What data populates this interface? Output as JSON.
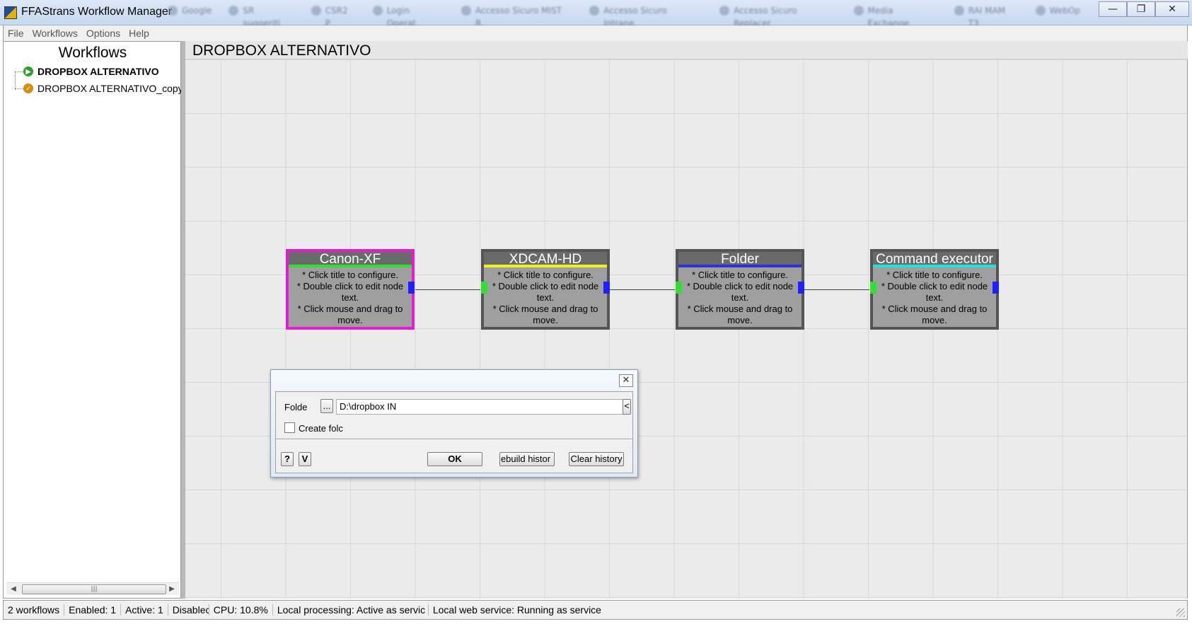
{
  "window": {
    "title": "FFAStrans Workflow Manager",
    "blurred_tabs": [
      "Google",
      "SR suggeriti",
      "CSR2 P",
      "Login Operat.",
      "Accesso Sicuro MIST R.",
      "Accesso Sicuro Intrane.",
      "Accesso Sicuro Replacer",
      "Media Exchange",
      "RAI MAM T3",
      "WebOp"
    ],
    "controls": {
      "minimize": "—",
      "maximize": "❐",
      "close": "✕"
    }
  },
  "menu": {
    "items": [
      "File",
      "Workflows",
      "Options",
      "Help"
    ]
  },
  "left_panel": {
    "title": "Workflows",
    "workflows": [
      {
        "name": "DROPBOX ALTERNATIVO",
        "status": "active",
        "icon": "play-icon",
        "selected": true
      },
      {
        "name": "DROPBOX ALTERNATIVO_copy",
        "status": "paused",
        "icon": "pause-icon",
        "selected": false
      }
    ],
    "scroll_left": "◀",
    "scroll_right": "▶",
    "scroll_grip": "|||"
  },
  "canvas": {
    "title": "DROPBOX ALTERNATIVO",
    "node_body_lines": [
      "* Click title to configure.",
      "* Double click to edit node",
      "text.",
      "* Click mouse and drag to",
      "move."
    ],
    "nodes": [
      {
        "title": "Canon-XF",
        "accent": "#33dd33",
        "selected": true
      },
      {
        "title": "XDCAM-HD",
        "accent": "#f0f020",
        "selected": false
      },
      {
        "title": "Folder",
        "accent": "#3030dd",
        "selected": false
      },
      {
        "title": "Command executor",
        "accent": "#20e0e0",
        "selected": false
      }
    ]
  },
  "dialog": {
    "close": "✕",
    "folder_label": "Folde",
    "browse_label": "...",
    "folder_value": "D:\\dropbox IN",
    "history_label": "<",
    "create_folder_label": "Create folc",
    "help_label": "?",
    "v_label": "V",
    "ok_label": "OK",
    "rebuild_label": "ebuild histor",
    "clear_label": "Clear history"
  },
  "statusbar": {
    "workflows_count": "2 workflows",
    "enabled": "Enabled: 1",
    "active": "Active: 1",
    "disabled": "Disablec",
    "cpu": "CPU: 10.8%",
    "local_processing": "Local processing: Active as servic",
    "web_service": "Local web service: Running as service"
  }
}
